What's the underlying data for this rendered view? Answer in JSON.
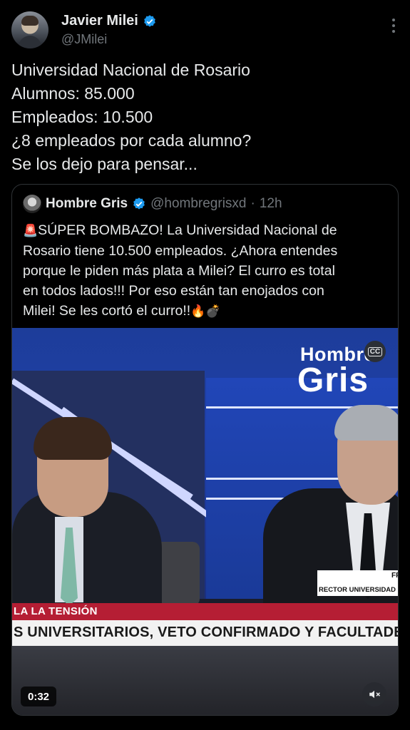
{
  "author": {
    "display_name": "Javier Milei",
    "handle": "@JMilei",
    "verified_icon": "verified-badge-icon",
    "more_icon": "more-options-icon"
  },
  "tweet": {
    "lines": [
      "Universidad Nacional de Rosario",
      "Alumnos: 85.000",
      "Empleados: 10.500",
      "¿8 empleados por cada alumno?",
      "Se los dejo para pensar..."
    ]
  },
  "quote": {
    "display_name": "Hombre Gris",
    "handle": "@hombregrisxd",
    "separator": "·",
    "time": "12h",
    "lines": [
      "SÚPER BOMBAZO! La Universidad Nacional de",
      "Rosario tiene 10.500 empleados. ¿Ahora entendes",
      "porque le piden más plata a Milei? El curro es total",
      "en todos lados!!! Por eso están tan enojados con",
      "Milei! Se les cortó el curro!!"
    ],
    "emoji_siren": "🚨",
    "emoji_fire": "🔥",
    "emoji_bomb": "💣"
  },
  "video": {
    "logo_line1": "Hombre",
    "logo_line2": "Gris",
    "cc_label": "CC",
    "nameplate_name": "FRANC",
    "nameplate_title": "RECTOR UNIVERSIDAD NACIO",
    "banner_red": "LA LA TENSIÓN",
    "banner_white": "S UNIVERSITARIOS, VETO CONFIRMADO Y FACULTADES TOMADAS",
    "duration": "0:32",
    "mute_icon": "muted-speaker-icon"
  },
  "colors": {
    "background": "#000000",
    "text_primary": "#e7e9ea",
    "text_secondary": "#71767b",
    "verified_blue": "#1d9bf0",
    "banner_red": "#b51e34"
  }
}
